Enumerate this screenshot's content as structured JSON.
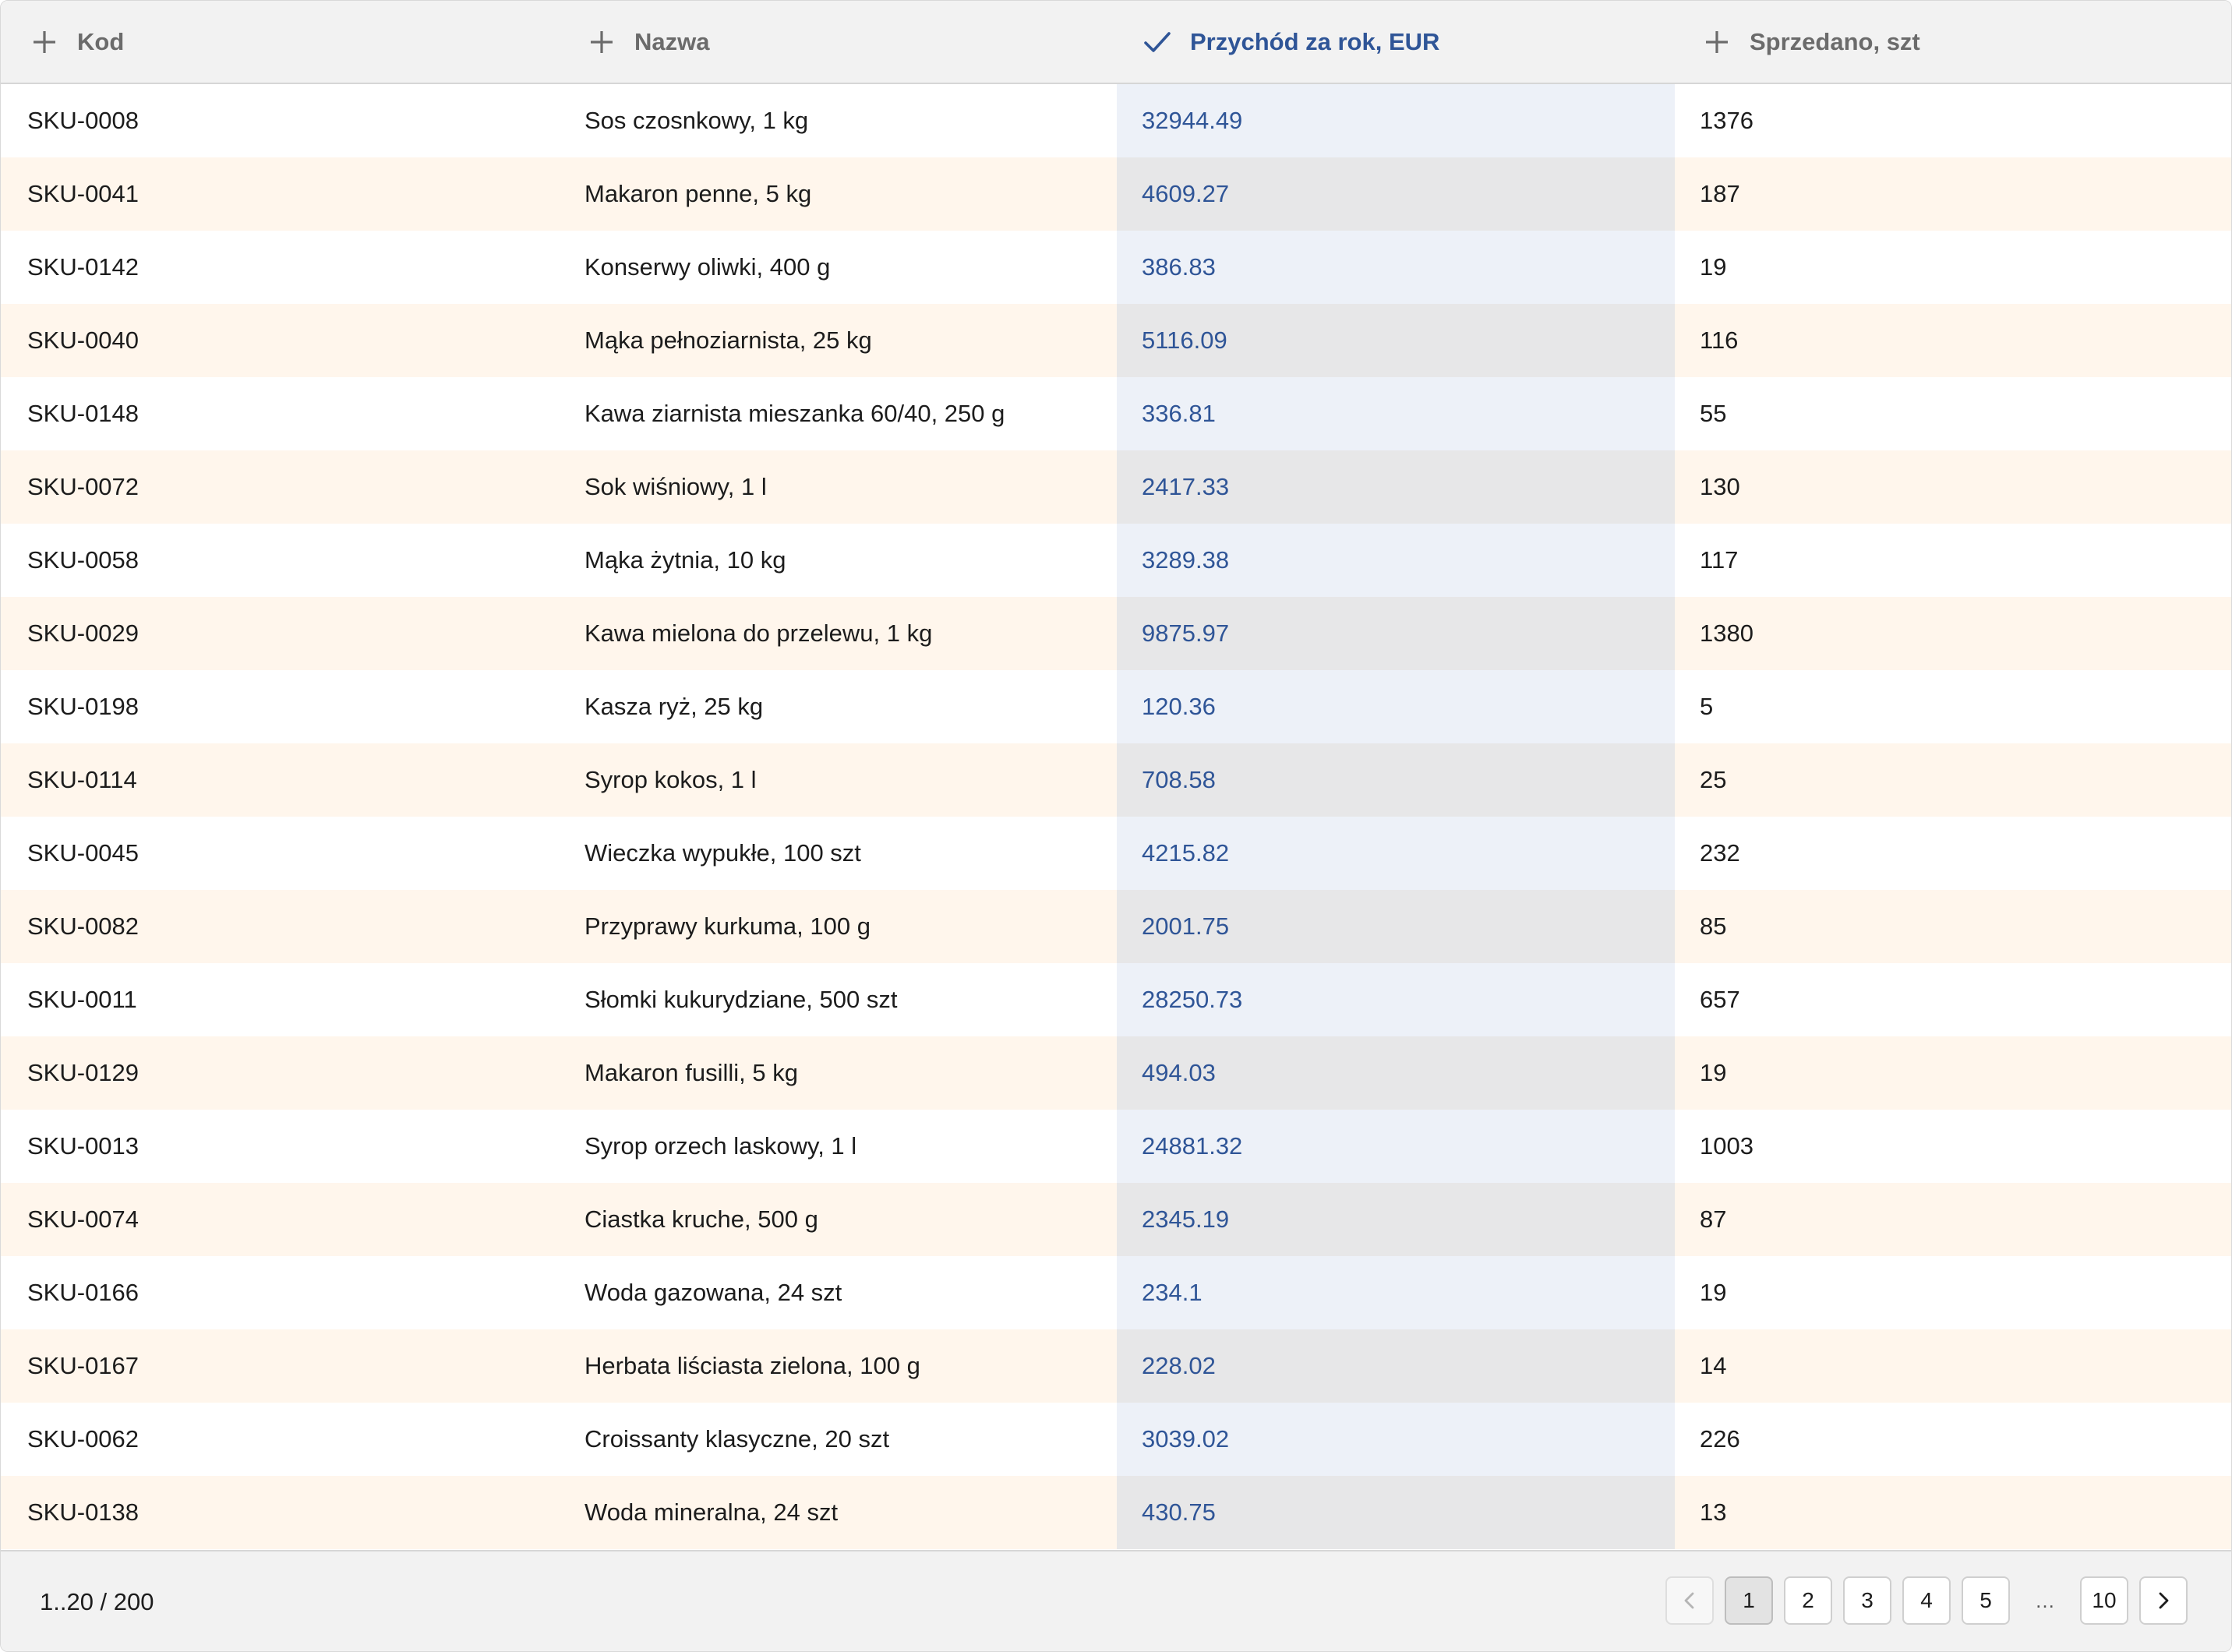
{
  "columns": [
    {
      "label": "Kod",
      "icon": "plus-icon",
      "sorted": false
    },
    {
      "label": "Nazwa",
      "icon": "plus-icon",
      "sorted": false
    },
    {
      "label": "Przychód za rok, EUR",
      "icon": "check-icon",
      "sorted": true
    },
    {
      "label": "Sprzedano, szt",
      "icon": "plus-icon",
      "sorted": false
    }
  ],
  "rows": [
    {
      "kod": "SKU-0008",
      "nazwa": "Sos czosnkowy, 1 kg",
      "przychod": "32944.49",
      "sprzedano": "1376"
    },
    {
      "kod": "SKU-0041",
      "nazwa": "Makaron penne, 5 kg",
      "przychod": "4609.27",
      "sprzedano": "187"
    },
    {
      "kod": "SKU-0142",
      "nazwa": "Konserwy oliwki, 400 g",
      "przychod": "386.83",
      "sprzedano": "19"
    },
    {
      "kod": "SKU-0040",
      "nazwa": "Mąka pełnoziarnista, 25 kg",
      "przychod": "5116.09",
      "sprzedano": "116"
    },
    {
      "kod": "SKU-0148",
      "nazwa": "Kawa ziarnista mieszanka 60/40, 250 g",
      "przychod": "336.81",
      "sprzedano": "55"
    },
    {
      "kod": "SKU-0072",
      "nazwa": "Sok wiśniowy, 1 l",
      "przychod": "2417.33",
      "sprzedano": "130"
    },
    {
      "kod": "SKU-0058",
      "nazwa": "Mąka żytnia, 10 kg",
      "przychod": "3289.38",
      "sprzedano": "117"
    },
    {
      "kod": "SKU-0029",
      "nazwa": "Kawa mielona do przelewu, 1 kg",
      "przychod": "9875.97",
      "sprzedano": "1380"
    },
    {
      "kod": "SKU-0198",
      "nazwa": "Kasza ryż, 25 kg",
      "przychod": "120.36",
      "sprzedano": "5"
    },
    {
      "kod": "SKU-0114",
      "nazwa": "Syrop kokos, 1 l",
      "przychod": "708.58",
      "sprzedano": "25"
    },
    {
      "kod": "SKU-0045",
      "nazwa": "Wieczka wypukłe, 100 szt",
      "przychod": "4215.82",
      "sprzedano": "232"
    },
    {
      "kod": "SKU-0082",
      "nazwa": "Przyprawy kurkuma, 100 g",
      "przychod": "2001.75",
      "sprzedano": "85"
    },
    {
      "kod": "SKU-0011",
      "nazwa": "Słomki kukurydziane, 500 szt",
      "przychod": "28250.73",
      "sprzedano": "657"
    },
    {
      "kod": "SKU-0129",
      "nazwa": "Makaron fusilli, 5 kg",
      "przychod": "494.03",
      "sprzedano": "19"
    },
    {
      "kod": "SKU-0013",
      "nazwa": "Syrop orzech laskowy, 1 l",
      "przychod": "24881.32",
      "sprzedano": "1003"
    },
    {
      "kod": "SKU-0074",
      "nazwa": "Ciastka kruche, 500 g",
      "przychod": "2345.19",
      "sprzedano": "87"
    },
    {
      "kod": "SKU-0166",
      "nazwa": "Woda gazowana, 24 szt",
      "przychod": "234.1",
      "sprzedano": "19"
    },
    {
      "kod": "SKU-0167",
      "nazwa": "Herbata liściasta zielona, 100 g",
      "przychod": "228.02",
      "sprzedano": "14"
    },
    {
      "kod": "SKU-0062",
      "nazwa": "Croissanty klasyczne, 20 szt",
      "przychod": "3039.02",
      "sprzedano": "226"
    },
    {
      "kod": "SKU-0138",
      "nazwa": "Woda mineralna, 24 szt",
      "przychod": "430.75",
      "sprzedano": "13"
    }
  ],
  "footer": {
    "range": "1..20 / 200",
    "pages": [
      "1",
      "2",
      "3",
      "4",
      "5"
    ],
    "ellipsis": "…",
    "last_page": "10",
    "current_page": "1"
  },
  "colors": {
    "accent": "#2f5597",
    "row_alt": "#fff6ec",
    "sorted_column_bg": "#edf1f8"
  }
}
